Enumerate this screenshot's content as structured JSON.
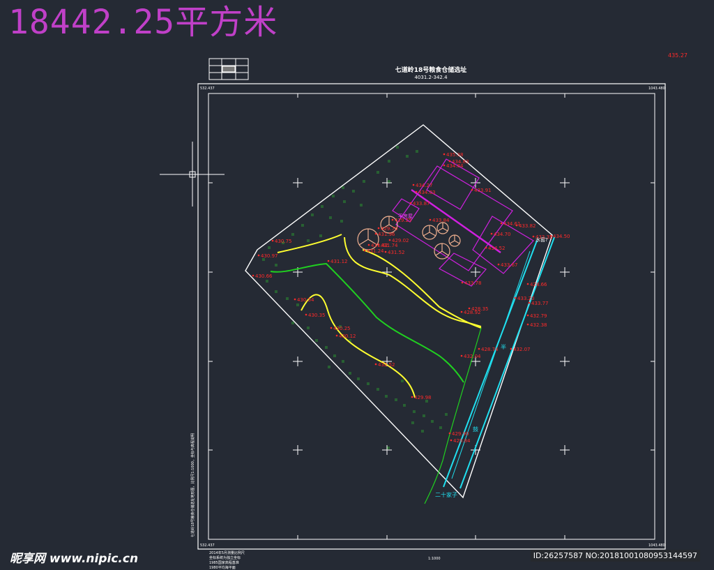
{
  "header": {
    "area_title": "18442.25平方米",
    "corner_elevation": "435.27"
  },
  "sheet": {
    "title": "七道岭18号粮食仓储选址",
    "subtitle": "4031.2-342.4",
    "scale": "1:1000",
    "notes": [
      "2014年5月测量比例尺",
      "坐标系统为独立坐标",
      "1985国家高程基准",
      "1980平均海平面"
    ],
    "corner_labels": [
      "532.437",
      "1043.480",
      "532.437",
      "1043.480"
    ],
    "side_note": "七道岭18号粮食仓储选址地形图，比例尺1:1000，坐标与高程说明"
  },
  "map_labels": {
    "cn_small_building": "平房屋",
    "cn_road_1": "半",
    "cn_road_2": "鼓",
    "cn_bottom_place": "二十家子",
    "cn_top_right": "水窖?"
  },
  "elevations": [
    "435.38",
    "434.84",
    "434.83",
    "433.91",
    "434.27",
    "434.03",
    "433.87",
    "433.84",
    "434.61",
    "434.70",
    "434.52",
    "433.67",
    "433.78",
    "433.82",
    "433.32",
    "434.50",
    "433.20",
    "433.77",
    "432.79",
    "432.38",
    "432.07",
    "432.04",
    "432.52",
    "431.96",
    "431.74",
    "431.52",
    "431.42",
    "431.24",
    "431.12",
    "430.97",
    "430.75",
    "430.66",
    "430.54",
    "430.35",
    "430.25",
    "430.12",
    "429.98",
    "429.90",
    "429.84",
    "429.25",
    "429.70",
    "429.02",
    "428.92",
    "428.74",
    "428.66",
    "428.35"
  ],
  "watermark": {
    "site": "昵享网 www.nipic.cn",
    "id": "ID:26257587 NO:20181001080953144597"
  },
  "colors": {
    "background": "#252a34",
    "boundary": "#ffffff",
    "annotation": "#ff2a2a",
    "building": "#d020e0",
    "contour_yellow": "#ffff30",
    "contour_green": "#20d020",
    "road": "#20e0f0",
    "tree": "#f0b090",
    "vegetation": "#30d030",
    "area_title": "#c040c8"
  }
}
